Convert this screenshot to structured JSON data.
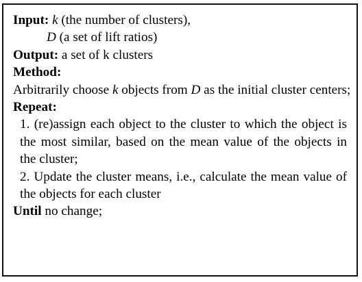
{
  "algorithm": {
    "input_label": "Input:",
    "input_k_var": "k",
    "input_k_desc": " (the number of clusters),",
    "input_d_var": "D",
    "input_d_desc": " (a set of lift ratios)",
    "output_label": "Output:",
    "output_desc": " a set of k clusters",
    "method_label": "Method:",
    "method_pre": "Arbitrarily choose ",
    "method_k": "k",
    "method_mid": " objects from ",
    "method_d": "D",
    "method_post": " as the initial cluster centers;",
    "repeat_label": "Repeat:",
    "step1": "1.  (re)assign each object to the cluster to which the object is the most similar, based on the mean value of the objects in the cluster;",
    "step2": "2.  Update the cluster means, i.e., calculate the mean value of the objects for each cluster",
    "until_label": "Until",
    "until_desc": " no change;"
  }
}
